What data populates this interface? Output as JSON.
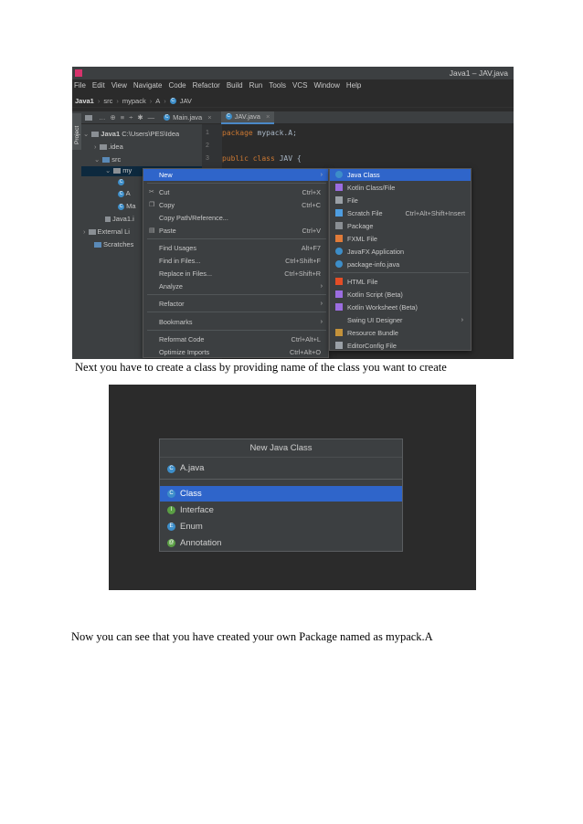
{
  "ide": {
    "window_title": "Java1 – JAV.java",
    "menu": [
      "File",
      "Edit",
      "View",
      "Navigate",
      "Code",
      "Refactor",
      "Build",
      "Run",
      "Tools",
      "VCS",
      "Window",
      "Help"
    ],
    "breadcrumb": [
      "Java1",
      "src",
      "mypack",
      "A",
      "JAV"
    ],
    "project_label": "Project",
    "tabs": [
      {
        "label": "Main.java"
      },
      {
        "label": "JAV.java"
      }
    ],
    "tree": [
      {
        "label": "Java1",
        "path": "C:\\Users\\PES\\Idea"
      },
      {
        "label": ".idea"
      },
      {
        "label": "src"
      },
      {
        "label": "my"
      },
      {
        "label": "A"
      },
      {
        "label": "Ma"
      },
      {
        "label": "Java1.i"
      },
      {
        "label": "External Li"
      },
      {
        "label": "Scratches"
      }
    ],
    "code": [
      {
        "num": "1",
        "kw": "package",
        "rest": " mypack.A;"
      },
      {
        "num": "2",
        "kw": "",
        "rest": ""
      },
      {
        "num": "3",
        "kw": "public class",
        "rest": " JAV {"
      }
    ],
    "context_menu": [
      {
        "label": "New",
        "shortcut": "",
        "submenu": true
      },
      {
        "label": "Cut",
        "shortcut": "Ctrl+X"
      },
      {
        "label": "Copy",
        "shortcut": "Ctrl+C"
      },
      {
        "label": "Copy Path/Reference...",
        "shortcut": ""
      },
      {
        "label": "Paste",
        "shortcut": "Ctrl+V"
      },
      {
        "label": "Find Usages",
        "shortcut": "Alt+F7"
      },
      {
        "label": "Find in Files...",
        "shortcut": "Ctrl+Shift+F"
      },
      {
        "label": "Replace in Files...",
        "shortcut": "Ctrl+Shift+R"
      },
      {
        "label": "Analyze",
        "shortcut": "",
        "submenu": true
      },
      {
        "label": "Refactor",
        "shortcut": "",
        "submenu": true
      },
      {
        "label": "Bookmarks",
        "shortcut": "",
        "submenu": true
      },
      {
        "label": "Reformat Code",
        "shortcut": "Ctrl+Alt+L"
      },
      {
        "label": "Optimize Imports",
        "shortcut": "Ctrl+Alt+O"
      }
    ],
    "new_submenu": [
      {
        "label": "Java Class",
        "shortcut": ""
      },
      {
        "label": "Kotlin Class/File",
        "shortcut": ""
      },
      {
        "label": "File",
        "shortcut": ""
      },
      {
        "label": "Scratch File",
        "shortcut": "Ctrl+Alt+Shift+Insert"
      },
      {
        "label": "Package",
        "shortcut": ""
      },
      {
        "label": "FXML File",
        "shortcut": ""
      },
      {
        "label": "JavaFX Application",
        "shortcut": ""
      },
      {
        "label": "package-info.java",
        "shortcut": ""
      },
      {
        "label": "HTML File",
        "shortcut": ""
      },
      {
        "label": "Kotlin Script (Beta)",
        "shortcut": ""
      },
      {
        "label": "Kotlin Worksheet (Beta)",
        "shortcut": ""
      },
      {
        "label": "Swing UI Designer",
        "shortcut": "",
        "submenu": true
      },
      {
        "label": "Resource Bundle",
        "shortcut": ""
      },
      {
        "label": "EditorConfig File",
        "shortcut": ""
      }
    ]
  },
  "caption1": "Next you have to create a class by providing name of the class you want to create",
  "dialog": {
    "title": "New Java Class",
    "input_value": "A.java",
    "options": [
      {
        "label": "Class",
        "color": "#3d8ec9",
        "letter": "C"
      },
      {
        "label": "Interface",
        "color": "#5a9e44",
        "letter": "I"
      },
      {
        "label": "Enum",
        "color": "#3d8ec9",
        "letter": "E"
      },
      {
        "label": "Annotation",
        "color": "#5a9e44",
        "letter": "@"
      }
    ]
  },
  "caption2": "Now you can see that you have created your own Package named as mypack.A",
  "colors": {
    "highlight": "#2f65ca",
    "ide_bg": "#2b2b2b",
    "panel_bg": "#3c3f41"
  }
}
